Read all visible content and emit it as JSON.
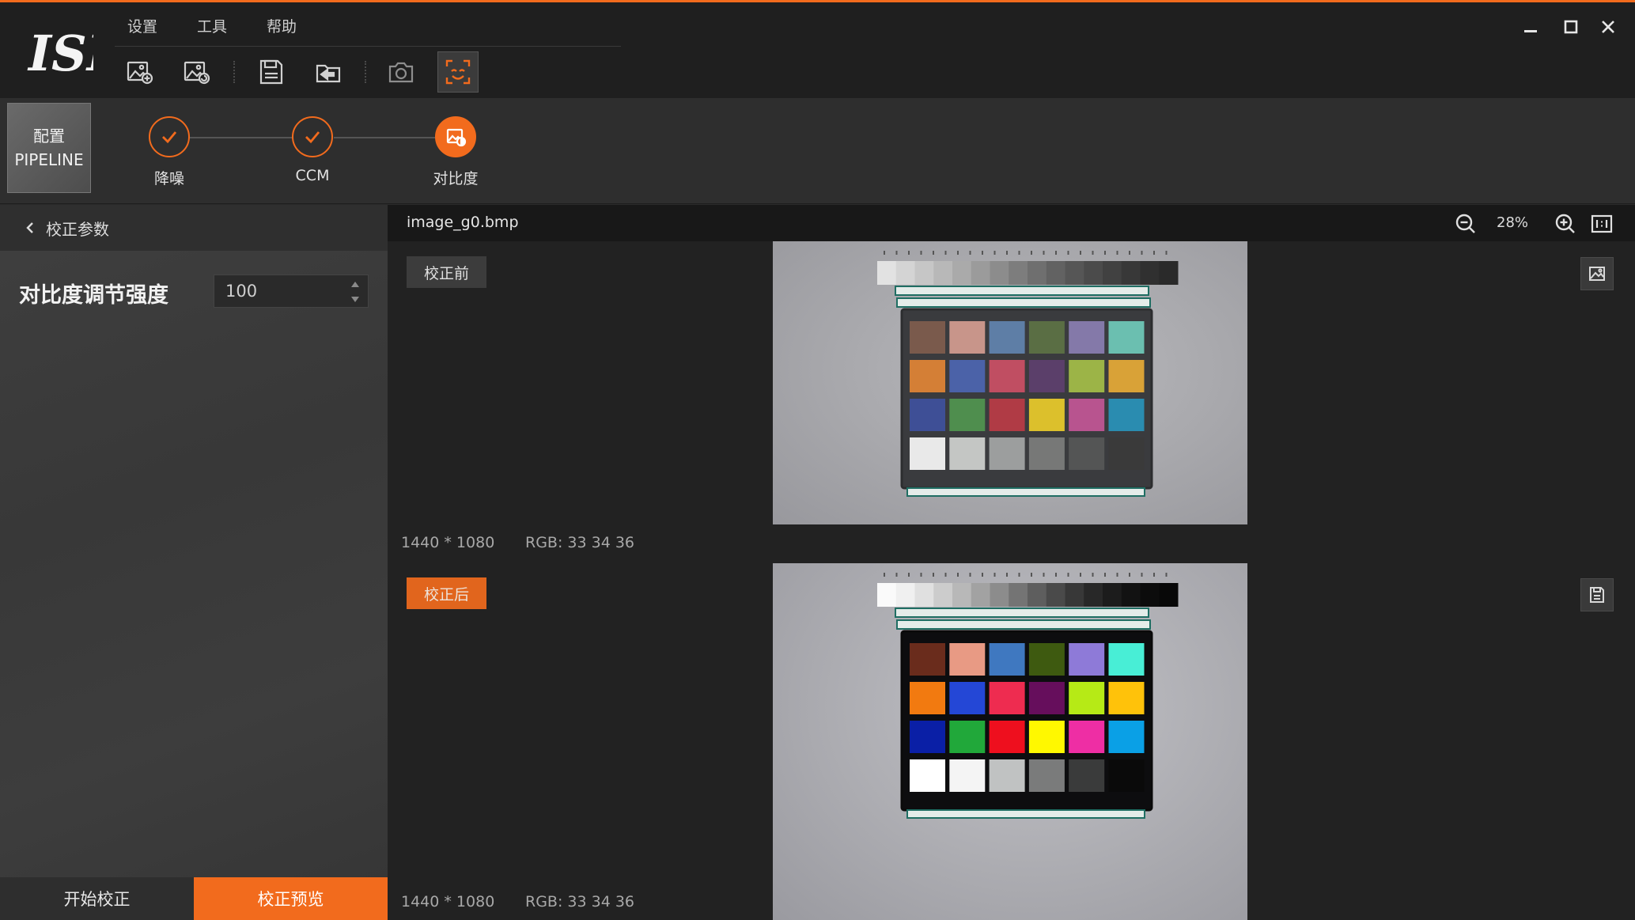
{
  "app": {
    "logo_text": "ISP",
    "accent_color": "#f26b1d"
  },
  "menu": [
    {
      "label": "设置"
    },
    {
      "label": "工具"
    },
    {
      "label": "帮助"
    }
  ],
  "toolbar": {
    "icons": [
      "open-image-add-icon",
      "open-image-refresh-icon",
      "save-icon",
      "import-icon",
      "camera-icon",
      "face-detect-icon"
    ],
    "active_icon": "face-detect-icon"
  },
  "window_controls": [
    "minimize-icon",
    "maximize-icon",
    "close-icon"
  ],
  "pipeline": {
    "config_label_line1": "配置",
    "config_label_line2": "PIPELINE",
    "stages": [
      {
        "label": "降噪",
        "status": "done"
      },
      {
        "label": "CCM",
        "status": "done"
      },
      {
        "label": "对比度",
        "status": "current"
      }
    ]
  },
  "left_panel": {
    "back_label": "校正参数",
    "param_label": "对比度调节强度",
    "param_value": "100",
    "start_button": "开始校正",
    "preview_button": "校正预览"
  },
  "viewer": {
    "filename": "image_g0.bmp",
    "zoom_level": "28%",
    "before_tag": "校正前",
    "after_tag": "校正后",
    "before_resolution": "1440 * 1080",
    "before_rgb": "RGB: 33 34 36",
    "after_resolution": "1440 * 1080",
    "after_rgb": "RGB: 33 34 36"
  },
  "colorchecker": {
    "before": [
      "#7a5a4c",
      "#c8958a",
      "#5e7ea6",
      "#5a6e44",
      "#8479a9",
      "#6bbfb0",
      "#d47f36",
      "#4b62a8",
      "#c04e62",
      "#5b3f6a",
      "#9cb447",
      "#d9a237",
      "#3e4f96",
      "#4f8e4e",
      "#b03b45",
      "#dcc02c",
      "#b8548f",
      "#2a8cb0",
      "#e9e9e9",
      "#c4c6c4",
      "#9c9e9e",
      "#777877",
      "#545555",
      "#3a3a3a"
    ],
    "after": [
      "#6a2c1c",
      "#e89a84",
      "#3f78c0",
      "#3e5a10",
      "#8e7ad8",
      "#48eed6",
      "#f27a10",
      "#2447d6",
      "#ee2c50",
      "#660e5c",
      "#b6ea16",
      "#ffc20a",
      "#0a1fa6",
      "#21a83a",
      "#ee0f1e",
      "#fff800",
      "#ee2ea4",
      "#0aa0e6",
      "#ffffff",
      "#f4f4f4",
      "#c0c2c2",
      "#7a7b7b",
      "#3a3b3b",
      "#0a0a0a"
    ],
    "gray_before": [
      "#e2e2e2",
      "#d4d4d4",
      "#c6c6c6",
      "#b8b8b8",
      "#aaaaaa",
      "#9b9b9b",
      "#8c8c8c",
      "#7d7d7d",
      "#6f6f6f",
      "#626262",
      "#565656",
      "#4b4b4b",
      "#414141",
      "#383838",
      "#303030",
      "#2a2a2a"
    ],
    "gray_after": [
      "#fafafa",
      "#f0f0f0",
      "#e0e0e0",
      "#cccccc",
      "#b8b8b8",
      "#a2a2a2",
      "#8c8c8c",
      "#747474",
      "#5e5e5e",
      "#4a4a4a",
      "#383838",
      "#282828",
      "#1c1c1c",
      "#121212",
      "#0c0c0c",
      "#080808"
    ]
  }
}
